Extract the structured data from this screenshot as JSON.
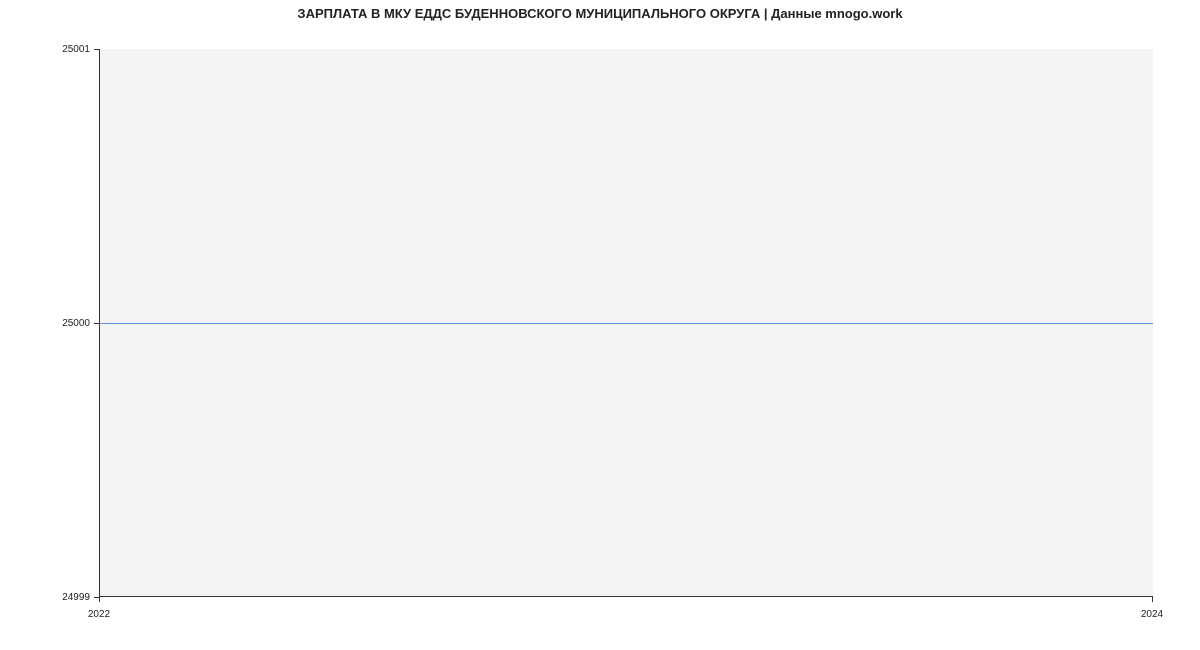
{
  "chart_data": {
    "type": "line",
    "title": "ЗАРПЛАТА В МКУ ЕДДС БУДЕННОВСКОГО МУНИЦИПАЛЬНОГО ОКРУГА | Данные mnogo.work",
    "x": [
      2022,
      2024
    ],
    "y": [
      25000,
      25000
    ],
    "x_ticks": [
      2022,
      2024
    ],
    "y_ticks": [
      24999,
      25000,
      25001
    ],
    "xlim": [
      2022,
      2024
    ],
    "ylim": [
      24999,
      25001
    ],
    "xlabel": "",
    "ylabel": ""
  },
  "y_labels": {
    "top": "25001",
    "mid": "25000",
    "bot": "24999"
  },
  "x_labels": {
    "left": "2022",
    "right": "2024"
  }
}
